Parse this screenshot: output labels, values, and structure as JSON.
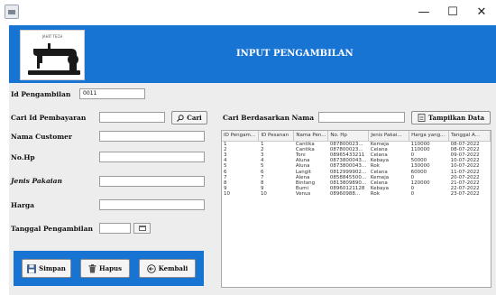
{
  "window": {
    "minimize": "—",
    "maximize": "☐",
    "close": "✕"
  },
  "banner": {
    "title": "INPUT PENGAMBILAN",
    "logo_text": "JAHIT TECH"
  },
  "form": {
    "id_pengambilan_label": "Id Pengambilan",
    "id_pengambilan_value": "0011",
    "cari_id_label": "Cari Id Pembayaran",
    "cari_button": "Cari",
    "nama_customer_label": "Nama Customer",
    "nohp_label": "No.Hp",
    "jenis_pakaian_label": "Jenis Pakaian",
    "harga_label": "Harga",
    "tanggal_label": "Tanggal Pengambilan"
  },
  "search": {
    "label": "Cari Berdasarkan Nama",
    "button": "Tampilkan Data"
  },
  "actions": {
    "simpan": "Simpan",
    "hapus": "Hapus",
    "kembali": "Kembali"
  },
  "table": {
    "columns": [
      "ID Pengam...",
      "ID Pesanan",
      "Nama Pen...",
      "No. Hp",
      "Jenis Pakai...",
      "Harga yang...",
      "Tanggal A..."
    ],
    "rows": [
      [
        "1",
        "1",
        "Cantika",
        "087800023...",
        "Kemeja",
        "110000",
        "08-07-2022"
      ],
      [
        "2",
        "2",
        "Cantika",
        "087800023...",
        "Celana",
        "110000",
        "08-07-2022"
      ],
      [
        "3",
        "3",
        "Toni",
        "08965433211",
        "Celana",
        "0",
        "09-07-2022"
      ],
      [
        "4",
        "4",
        "Aluna",
        "0873800043...",
        "Kebaya",
        "50000",
        "10-07-2022"
      ],
      [
        "5",
        "5",
        "Aluna",
        "0873800043...",
        "Rok",
        "130000",
        "10-07-2022"
      ],
      [
        "6",
        "6",
        "Langit",
        "0812999902...",
        "Celana",
        "60000",
        "11-07-2022"
      ],
      [
        "7",
        "7",
        "Alena",
        "0858845500...",
        "Kemeja",
        "0",
        "20-07-2022"
      ],
      [
        "8",
        "8",
        "Bintang",
        "0813809890...",
        "Celana",
        "120000",
        "21-07-2022"
      ],
      [
        "9",
        "9",
        "Bumi",
        "08960121128",
        "Kebaya",
        "0",
        "22-07-2022"
      ],
      [
        "10",
        "10",
        "Venus",
        "08960988...",
        "Rok",
        "0",
        "23-07-2022"
      ]
    ]
  }
}
